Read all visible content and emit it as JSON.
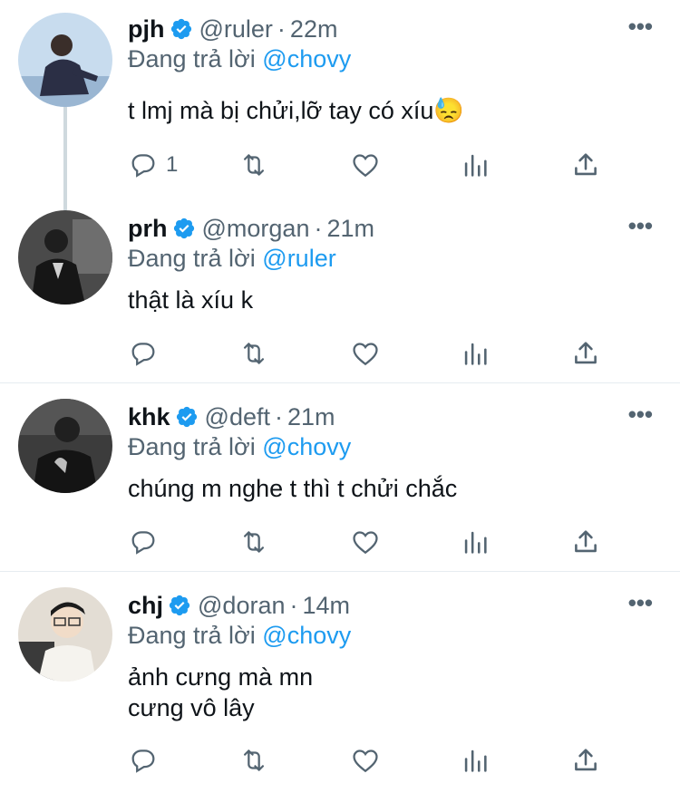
{
  "tweets": [
    {
      "name": "pjh",
      "handle": "@ruler",
      "separator": "·",
      "time": "22m",
      "replying_prefix": "Đang trả lời",
      "replying_to": "@chovy",
      "lines": [
        "t lmj mà bị chửi,lỡ tay có xíu😓"
      ],
      "reply_count": "1",
      "avatar_bg": "#b9d3ea"
    },
    {
      "name": "prh",
      "handle": "@morgan",
      "separator": "·",
      "time": "21m",
      "replying_prefix": "Đang trả lời",
      "replying_to": "@ruler",
      "lines": [
        "thật là xíu k"
      ],
      "reply_count": "",
      "avatar_bg": "#3a3a3a"
    },
    {
      "name": "khk",
      "handle": "@deft",
      "separator": "·",
      "time": "21m",
      "replying_prefix": "Đang trả lời",
      "replying_to": "@chovy",
      "lines": [
        "chúng m nghe t thì t chửi chắc"
      ],
      "reply_count": "",
      "avatar_bg": "#2a2a2a"
    },
    {
      "name": "chj",
      "handle": "@doran",
      "separator": "·",
      "time": "14m",
      "replying_prefix": "Đang trả lời",
      "replying_to": "@chovy",
      "lines": [
        "ảnh cưng mà mn",
        "cưng vô lây"
      ],
      "reply_count": "",
      "avatar_bg": "#d9d2c8"
    }
  ],
  "icons": {
    "more": "more-icon",
    "verified": "verified-badge-icon",
    "reply": "reply-icon",
    "retweet": "retweet-icon",
    "like": "like-icon",
    "views": "views-icon",
    "share": "share-icon"
  },
  "colors": {
    "accent": "#1d9bf0",
    "secondary_text": "#536471",
    "primary_text": "#0f1419"
  }
}
